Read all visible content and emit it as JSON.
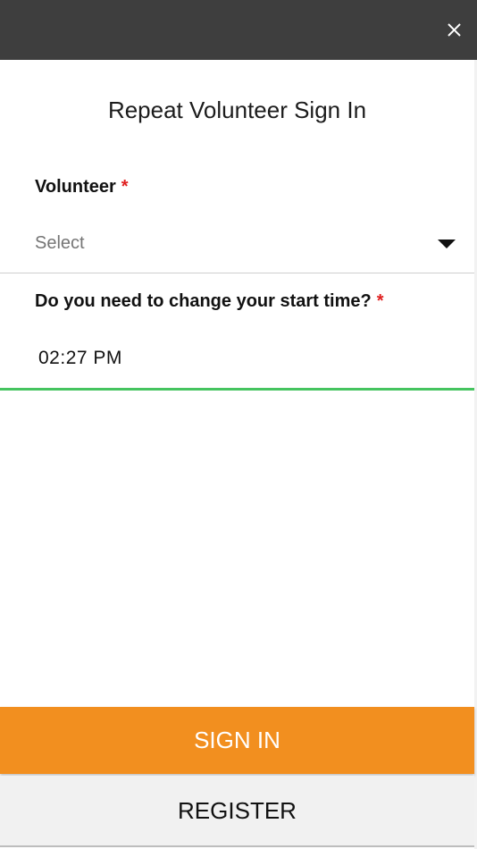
{
  "header": {
    "close_icon": "close-icon"
  },
  "form": {
    "title": "Repeat Volunteer Sign In",
    "volunteer": {
      "label": "Volunteer",
      "required_mark": "*",
      "placeholder": "Select"
    },
    "start_time": {
      "label": "Do you need to change your start time?",
      "required_mark": "*",
      "value": "02:27 PM"
    }
  },
  "actions": {
    "sign_in_label": "SIGN IN",
    "register_label": "REGISTER"
  },
  "colors": {
    "topbar": "#3e3e3e",
    "accent_orange": "#f28f1f",
    "focus_green": "#45c45f",
    "required_red": "#e02020"
  }
}
